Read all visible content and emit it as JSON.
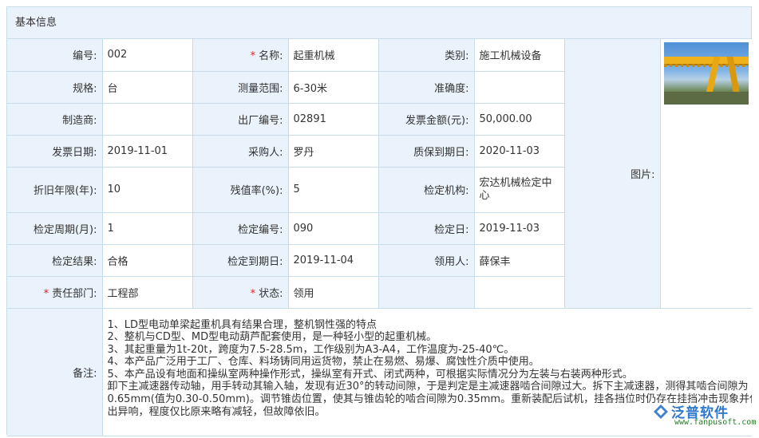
{
  "panel": {
    "title": "基本信息"
  },
  "fields": {
    "code": {
      "label": "编号:",
      "value": "002"
    },
    "name": {
      "label": "名称:",
      "value": "起重机械",
      "required": true
    },
    "category": {
      "label": "类别:",
      "value": "施工机械设备"
    },
    "spec": {
      "label": "规格:",
      "value": "台"
    },
    "range": {
      "label": "测量范围:",
      "value": "6-30米"
    },
    "accuracy": {
      "label": "准确度:",
      "value": ""
    },
    "maker": {
      "label": "制造商:",
      "value": ""
    },
    "factory_no": {
      "label": "出厂编号:",
      "value": "02891"
    },
    "invoice_amount": {
      "label": "发票金额(元):",
      "value": "50,000.00"
    },
    "invoice_date": {
      "label": "发票日期:",
      "value": "2019-11-01"
    },
    "buyer": {
      "label": "采购人:",
      "value": "罗丹"
    },
    "warranty_date": {
      "label": "质保到期日:",
      "value": "2020-11-03"
    },
    "depreciation_years": {
      "label": "折旧年限(年):",
      "value": "10"
    },
    "residual_rate": {
      "label": "残值率(%):",
      "value": "5"
    },
    "inspection_org": {
      "label": "检定机构:",
      "value": "宏达机械检定中心"
    },
    "inspection_cycle": {
      "label": "检定周期(月):",
      "value": "1"
    },
    "inspection_no": {
      "label": "检定编号:",
      "value": "090"
    },
    "inspection_date": {
      "label": "检定日:",
      "value": "2019-11-03"
    },
    "inspection_result": {
      "label": "检定结果:",
      "value": "合格"
    },
    "inspection_due": {
      "label": "检定到期日:",
      "value": "2019-11-04"
    },
    "receiver": {
      "label": "领用人:",
      "value": "薛保丰"
    },
    "department": {
      "label": "责任部门:",
      "value": "工程部",
      "required": true
    },
    "status": {
      "label": "状态:",
      "value": "领用",
      "required": true
    },
    "picture": {
      "label": "图片:"
    }
  },
  "remark": {
    "label": "备注:",
    "lines": [
      "1、LD型电动单梁起重机具有结果合理，整机钢性强的特点",
      "2、整机与CD型、MD型电动葫芦配套使用，是一种轻小型的起重机械。",
      "3、其起重量为1t-20t，跨度为7.5-28.5m，工作级别为A3-A4，工作温度为-25-40℃。",
      "4、本产品广泛用于工厂、仓库、料场铸同用运货物，禁止在易燃、易爆、腐蚀性介质中使用。",
      "5、本产品设有地面和操纵室两种操作形式，操纵室有开式、闭式两种，可根据实际情况分为左装与右装两种形式。",
      "卸下主减速器传动轴，用手转动其输入轴，发现有近30°的转动间隙，于是判定是主减速器啮合间隙过大。拆下主减速器，测得其啮合间隙为",
      "0.65mm(值为0.30-0.50mm)。调节锥齿位置，使其与锥齿轮的啮合间隙为0.35mm。重新装配后试机，挂各挡位时仍存在挂挡冲击现象并伴",
      "出异响，程度仅比原来略有减轻，但故障依旧。"
    ]
  },
  "watermark": {
    "brand": "泛普软件",
    "url": "www.fanpusoft.com"
  },
  "colors": {
    "label_bg": "#eaf2fb",
    "border": "#c8dbe8",
    "required": "#e02020"
  }
}
